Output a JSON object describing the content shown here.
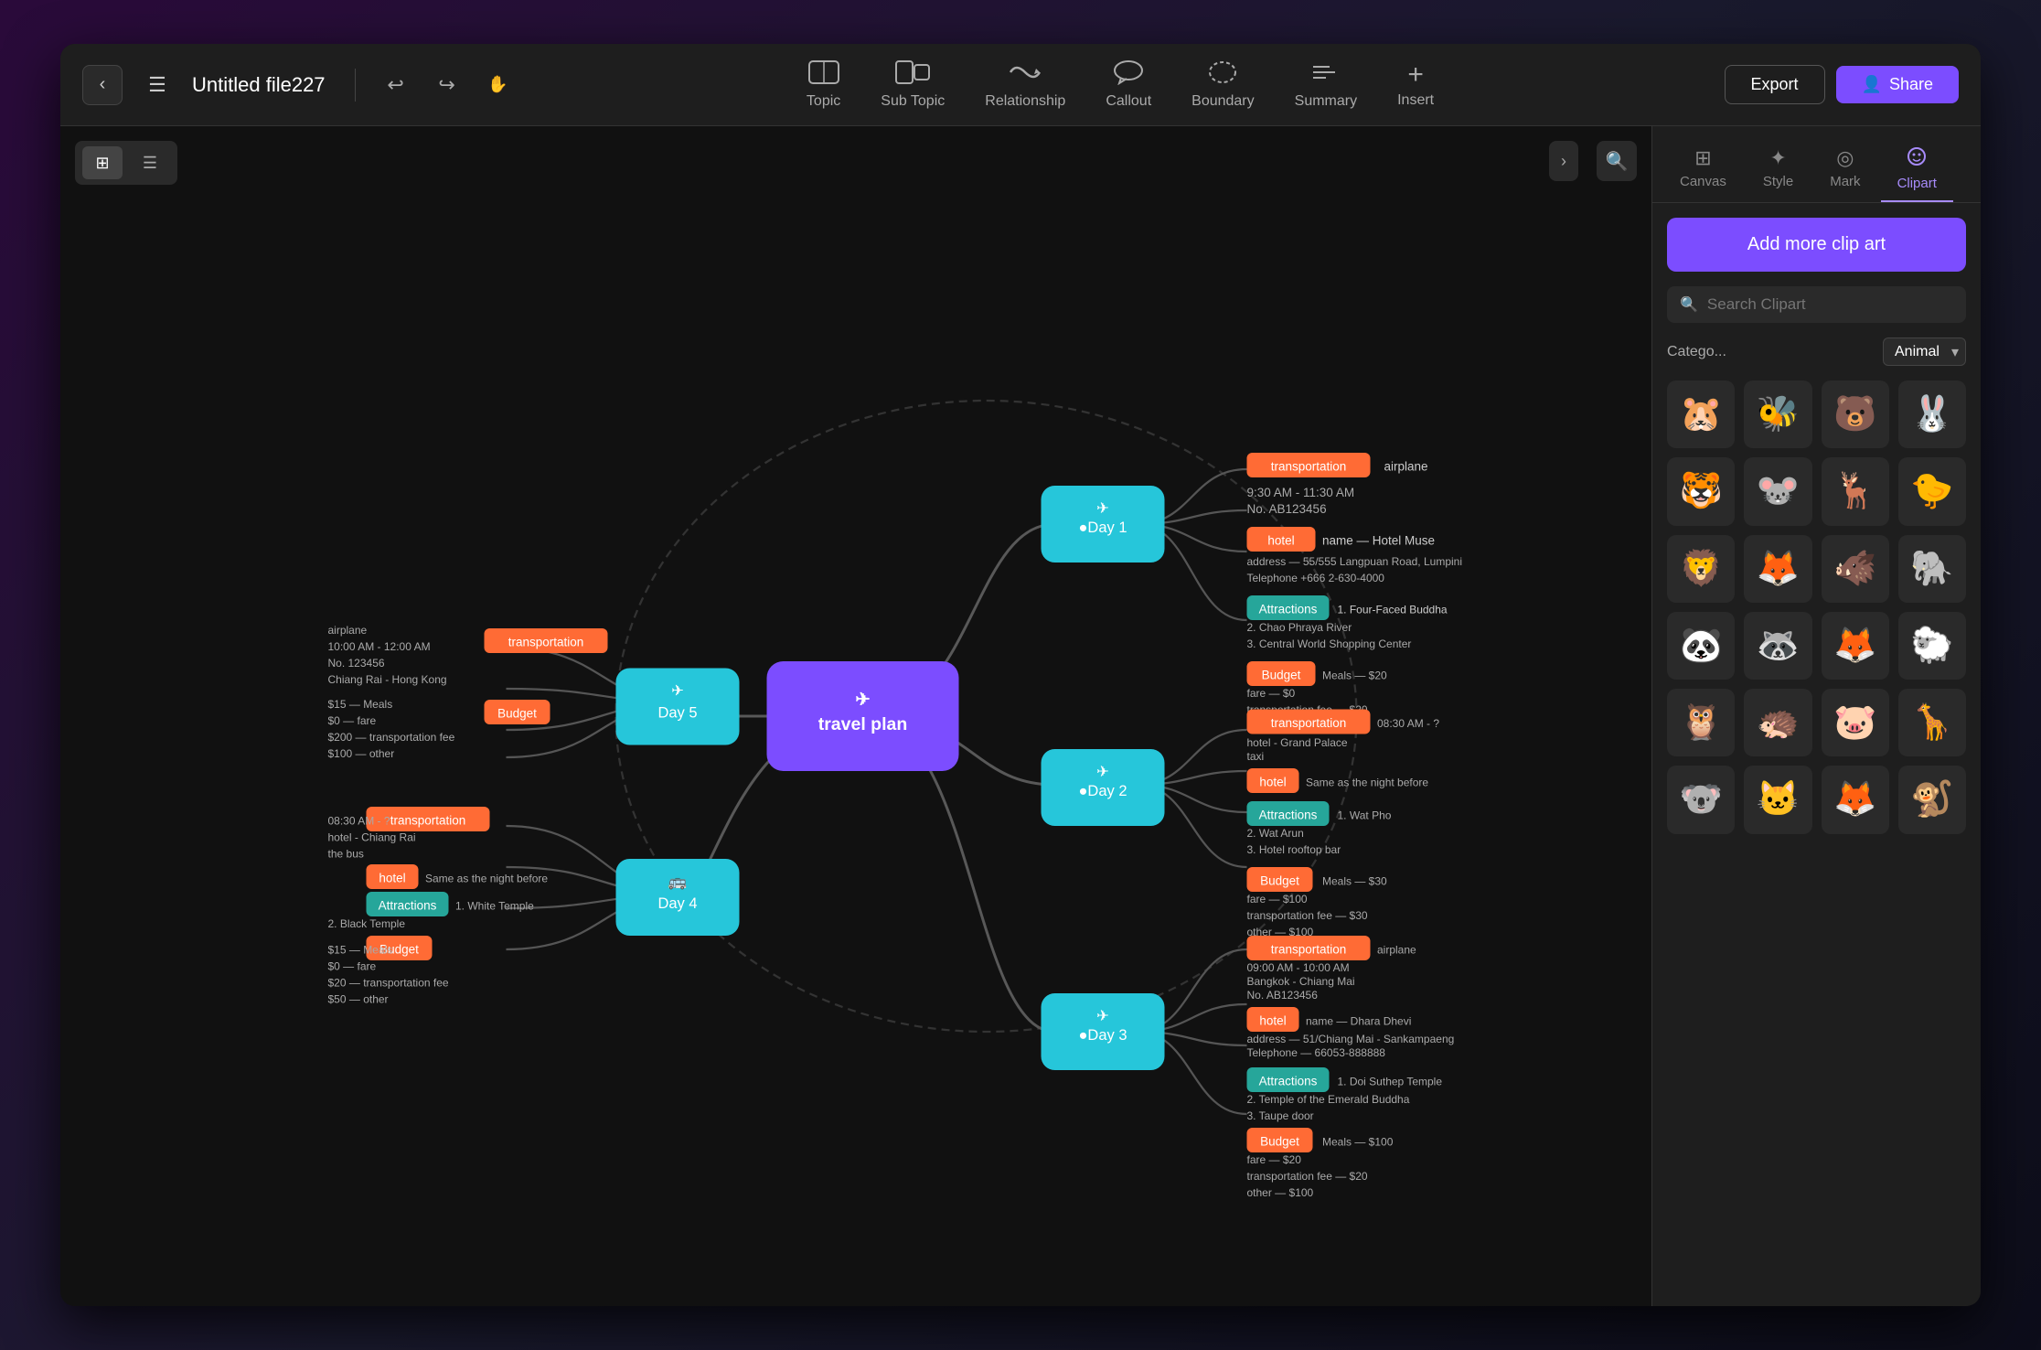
{
  "toolbar": {
    "back_label": "‹",
    "hamburger_label": "☰",
    "file_title": "Untitled file227",
    "undo_label": "↩",
    "redo_label": "↪",
    "hand_tool": "✋",
    "tools": [
      {
        "id": "topic",
        "icon": "⬛",
        "label": "Topic"
      },
      {
        "id": "subtopic",
        "icon": "⬜",
        "label": "Sub Topic"
      },
      {
        "id": "relationship",
        "icon": "↩",
        "label": "Relationship"
      },
      {
        "id": "callout",
        "icon": "💬",
        "label": "Callout"
      },
      {
        "id": "boundary",
        "icon": "⊡",
        "label": "Boundary"
      },
      {
        "id": "summary",
        "icon": "☰",
        "label": "Summary"
      },
      {
        "id": "insert",
        "icon": "+",
        "label": "Insert"
      }
    ],
    "export_label": "Export",
    "share_label": "Share"
  },
  "panel": {
    "tabs": [
      {
        "id": "canvas",
        "icon": "⊞",
        "label": "Canvas"
      },
      {
        "id": "style",
        "icon": "✦",
        "label": "Style"
      },
      {
        "id": "mark",
        "icon": "◎",
        "label": "Mark"
      },
      {
        "id": "clipart",
        "icon": "✿",
        "label": "Clipart",
        "active": true
      }
    ],
    "add_clipart_label": "Add more clip art",
    "search_placeholder": "Search Clipart",
    "category_label": "Catego...",
    "category_value": "Animal",
    "animals": [
      "🐹",
      "🐝",
      "🐻",
      "🐰",
      "🐯",
      "🐭",
      "🦌",
      "🐤",
      "🦁",
      "🦊",
      "🐗",
      "🐘",
      "🐼",
      "🦝",
      "🦊",
      "🐑",
      "🦉",
      "🦔",
      "🐷",
      "🦒",
      "🐨",
      "🐱",
      "🦊",
      "🐒"
    ]
  },
  "canvas": {
    "search_btn": "🔍",
    "expand_btn": "›",
    "view_grid_label": "⊞",
    "view_list_label": "☰"
  }
}
